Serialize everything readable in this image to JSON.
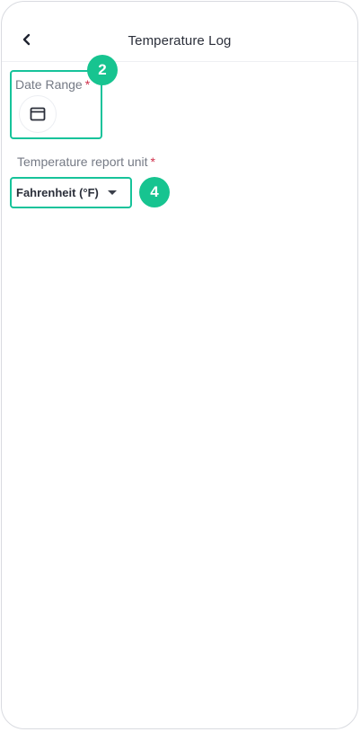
{
  "header": {
    "title": "Temperature Log",
    "back_icon": "chevron-left-icon"
  },
  "date_range": {
    "label": "Date Range",
    "required_mark": "*",
    "icon": "calendar-icon",
    "annotation_number": "2"
  },
  "temperature_unit": {
    "label": "Temperature report unit",
    "required_mark": "*",
    "selected_value": "Fahrenheit (°F)",
    "annotation_number": "4"
  },
  "colors": {
    "highlight": "#16c39a",
    "badge": "#17c490",
    "required": "#d0314c"
  }
}
